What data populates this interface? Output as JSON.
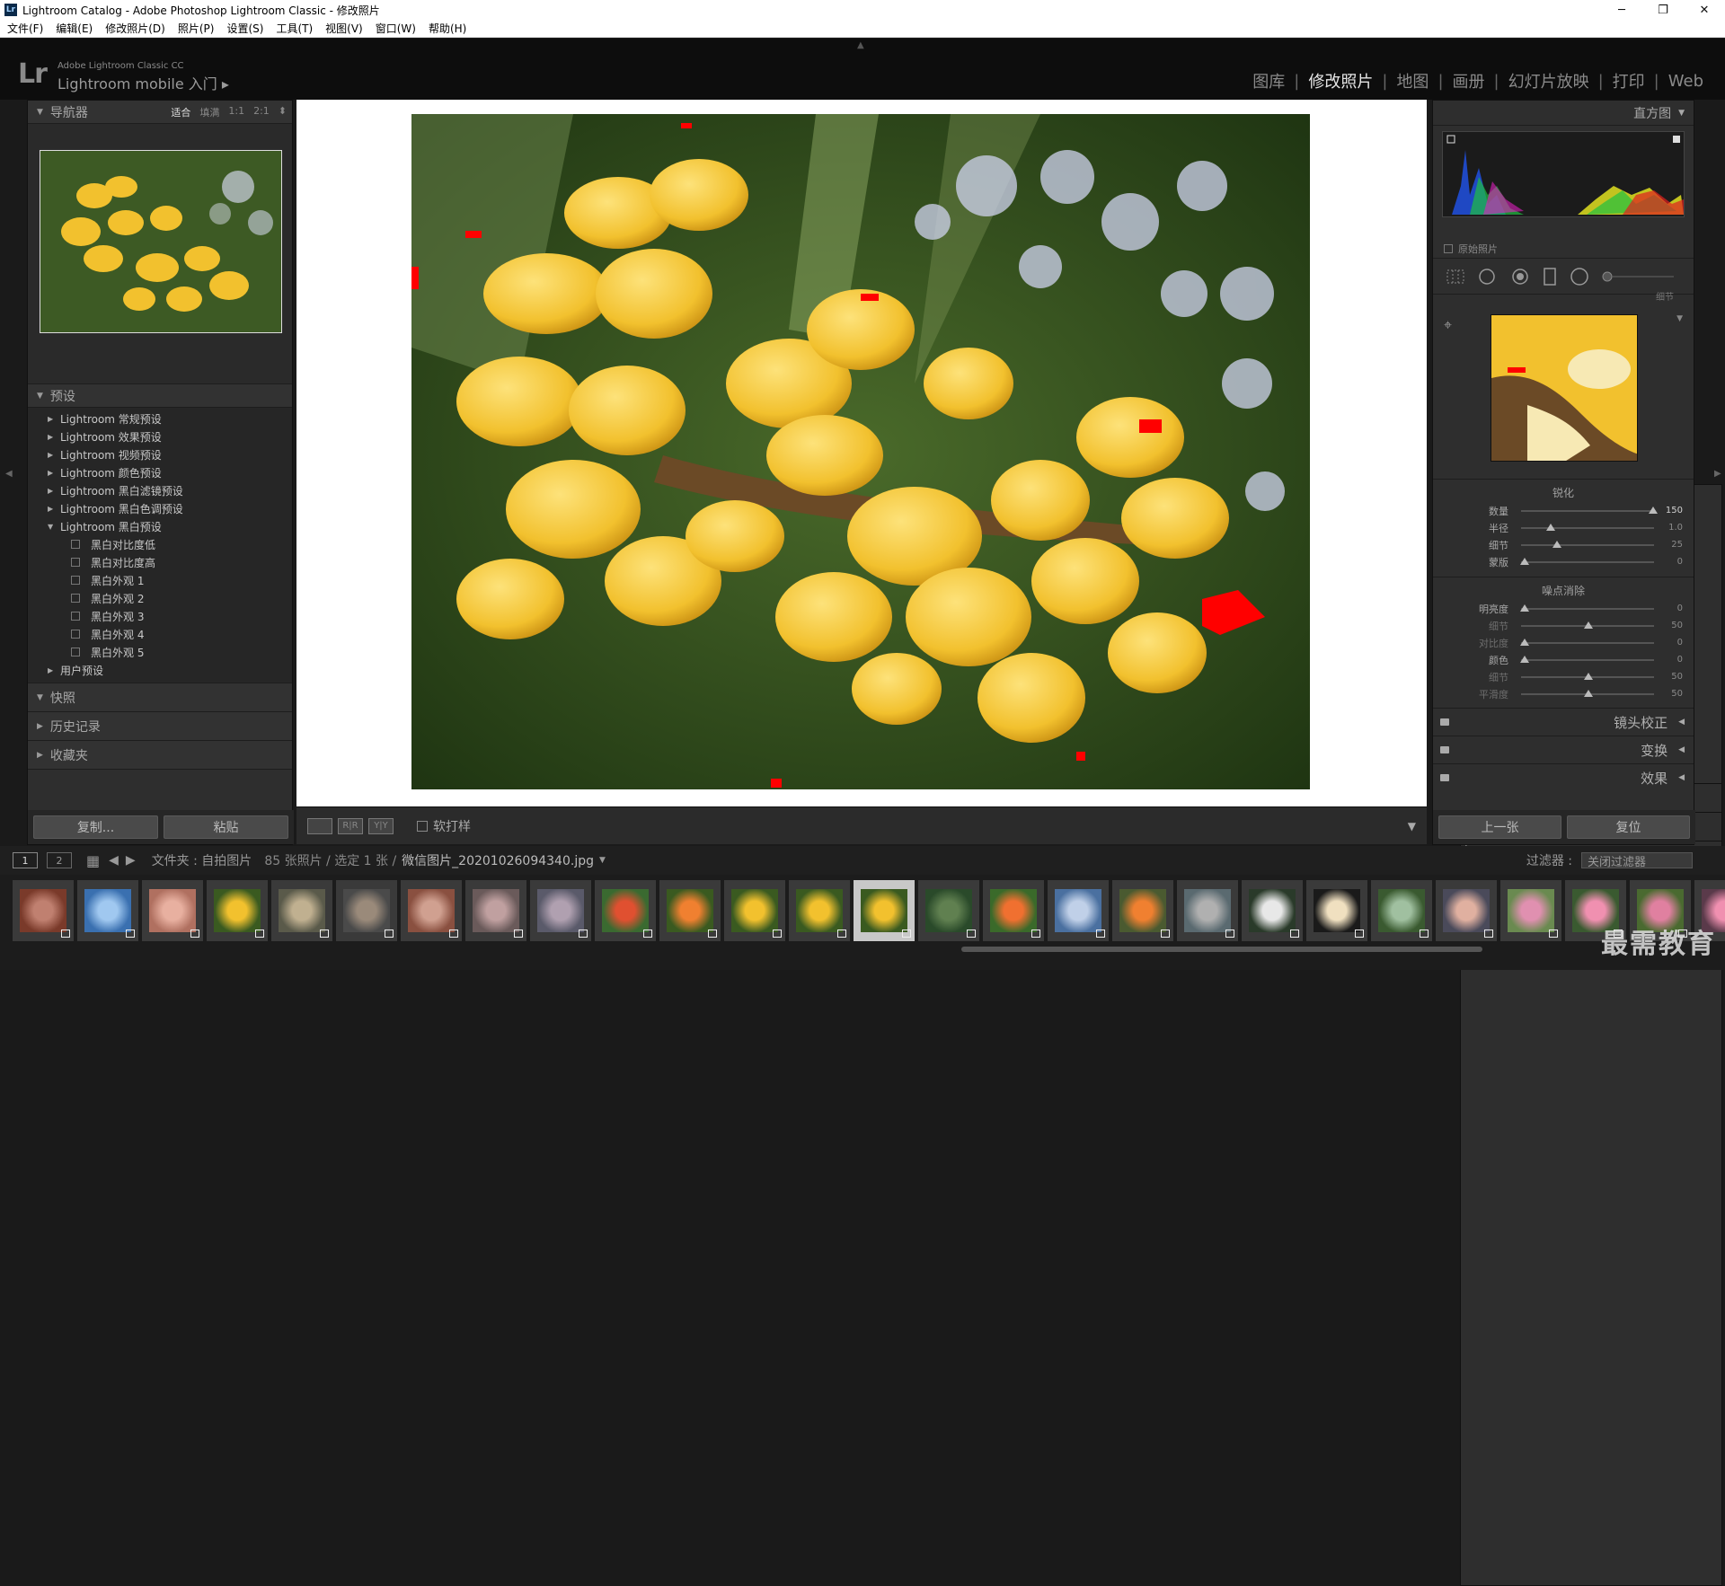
{
  "window": {
    "title": "Lightroom Catalog - Adobe Photoshop Lightroom Classic - 修改照片",
    "minimize": "─",
    "maximize": "❐",
    "close": "✕"
  },
  "menu": [
    "文件(F)",
    "编辑(E)",
    "修改照片(D)",
    "照片(P)",
    "设置(S)",
    "工具(T)",
    "视图(V)",
    "窗口(W)",
    "帮助(H)"
  ],
  "identity": {
    "logo": "Lr",
    "product": "Adobe Lightroom Classic CC",
    "mobile": "Lightroom mobile 入门  ▸"
  },
  "modules": [
    {
      "label": "图库",
      "active": false
    },
    {
      "label": "修改照片",
      "active": true
    },
    {
      "label": "地图",
      "active": false
    },
    {
      "label": "画册",
      "active": false
    },
    {
      "label": "幻灯片放映",
      "active": false
    },
    {
      "label": "打印",
      "active": false
    },
    {
      "label": "Web",
      "active": false
    }
  ],
  "navigator": {
    "title": "导航器",
    "zoom": [
      "适合",
      "填满",
      "1:1",
      "2:1"
    ],
    "zoom_selected": "适合",
    "zoom_more": "⬍"
  },
  "presets": {
    "title": "预设",
    "add": "+",
    "items": [
      {
        "label": "Lightroom 常规预设",
        "open": false,
        "sub": false
      },
      {
        "label": "Lightroom 效果预设",
        "open": false,
        "sub": false
      },
      {
        "label": "Lightroom 视频预设",
        "open": false,
        "sub": false
      },
      {
        "label": "Lightroom 颜色预设",
        "open": false,
        "sub": false
      },
      {
        "label": "Lightroom 黑白滤镜预设",
        "open": false,
        "sub": false
      },
      {
        "label": "Lightroom 黑白色调预设",
        "open": false,
        "sub": false
      },
      {
        "label": "Lightroom 黑白预设",
        "open": true,
        "sub": false
      },
      {
        "label": "黑白对比度低",
        "sub": true
      },
      {
        "label": "黑白对比度高",
        "sub": true
      },
      {
        "label": "黑白外观 1",
        "sub": true
      },
      {
        "label": "黑白外观 2",
        "sub": true
      },
      {
        "label": "黑白外观 3",
        "sub": true
      },
      {
        "label": "黑白外观 4",
        "sub": true
      },
      {
        "label": "黑白外观 5",
        "sub": true
      },
      {
        "label": "用户预设",
        "open": false,
        "sub": false
      }
    ]
  },
  "snapshots": {
    "title": "快照",
    "action": "+"
  },
  "history": {
    "title": "历史记录",
    "action": "×"
  },
  "collections": {
    "title": "收藏夹",
    "action": "+."
  },
  "left_buttons": {
    "copy": "复制...",
    "paste": "粘贴"
  },
  "toolbar": {
    "view1": "",
    "view2": "R|R",
    "view3": "Y|Y",
    "softproof": "软打样"
  },
  "histogram": {
    "title": "直方图",
    "original": "原始照片"
  },
  "detail": {
    "sub_label": "细节",
    "sharpen": {
      "title": "锐化",
      "rows": [
        {
          "label": "数量",
          "value": "150",
          "pos": 0.99,
          "dim": false,
          "bright": true
        },
        {
          "label": "半径",
          "value": "1.0",
          "pos": 0.22,
          "dim": false,
          "bright": false
        },
        {
          "label": "细节",
          "value": "25",
          "pos": 0.27,
          "dim": false,
          "bright": false
        },
        {
          "label": "蒙版",
          "value": "0",
          "pos": 0.03,
          "dim": false,
          "bright": false
        }
      ]
    },
    "noise": {
      "title": "噪点消除",
      "rows": [
        {
          "label": "明亮度",
          "value": "0",
          "pos": 0.03,
          "dim": false
        },
        {
          "label": "细节",
          "value": "50",
          "pos": 0.51,
          "dim": true
        },
        {
          "label": "对比度",
          "value": "0",
          "pos": 0.03,
          "dim": true
        },
        {
          "label": "颜色",
          "value": "0",
          "pos": 0.03,
          "dim": false
        },
        {
          "label": "细节",
          "value": "50",
          "pos": 0.51,
          "dim": true
        },
        {
          "label": "平滑度",
          "value": "50",
          "pos": 0.51,
          "dim": true
        }
      ]
    }
  },
  "collapsed_panels": [
    "镜头校正",
    "变换",
    "效果"
  ],
  "right_buttons": {
    "prev": "上一张",
    "reset": "复位"
  },
  "filmstrip": {
    "screen1": "1",
    "screen2": "2",
    "path": "文件夹 : 自拍图片",
    "count": "85 张照片 / 选定 1 张 /",
    "filename": "微信图片_20201026094340.jpg",
    "filter_label": "过滤器 :",
    "filter_value": "关闭过滤器",
    "watermark": "最需教育"
  },
  "colors": {
    "accent": "#e6e6e6",
    "flower": "#f2c12e",
    "clip_red": "#ff0000"
  }
}
